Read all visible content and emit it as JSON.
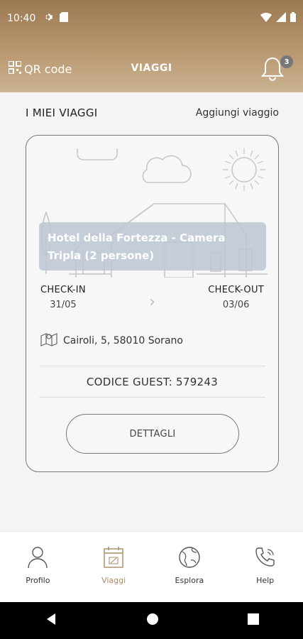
{
  "status_bar": {
    "time": "10:40",
    "icons_left": [
      "gear-icon",
      "sd-card-icon"
    ],
    "icons_right": [
      "wifi-icon",
      "signal-icon",
      "battery-icon"
    ]
  },
  "header": {
    "qr_label": "QR code",
    "title": "VIAGGI",
    "notification_count": "3"
  },
  "section": {
    "title": "I MIEI VIAGGI",
    "add_label": "Aggiungi viaggio"
  },
  "trip": {
    "hotel": "Hotel della Fortezza - Camera Tripla (2 persone)",
    "checkin_label": "CHECK-IN",
    "checkin_date": "31/05",
    "checkout_label": "CHECK-OUT",
    "checkout_date": "03/06",
    "address": "Cairoli, 5, 58010 Sorano",
    "guest_code": "CODICE GUEST: 579243",
    "details_label": "DETTAGLI"
  },
  "bottom_nav": {
    "items": [
      {
        "label": "Profilo",
        "icon": "person-icon"
      },
      {
        "label": "Viaggi",
        "icon": "calendar-icon"
      },
      {
        "label": "Esplora",
        "icon": "globe-icon"
      },
      {
        "label": "Help",
        "icon": "phone-icon"
      }
    ],
    "active_index": 1
  },
  "colors": {
    "header_top": "#9b7a52",
    "header_bottom": "#cbb391",
    "accent": "#a88a63",
    "hotel_band": "#bcc6d4"
  }
}
